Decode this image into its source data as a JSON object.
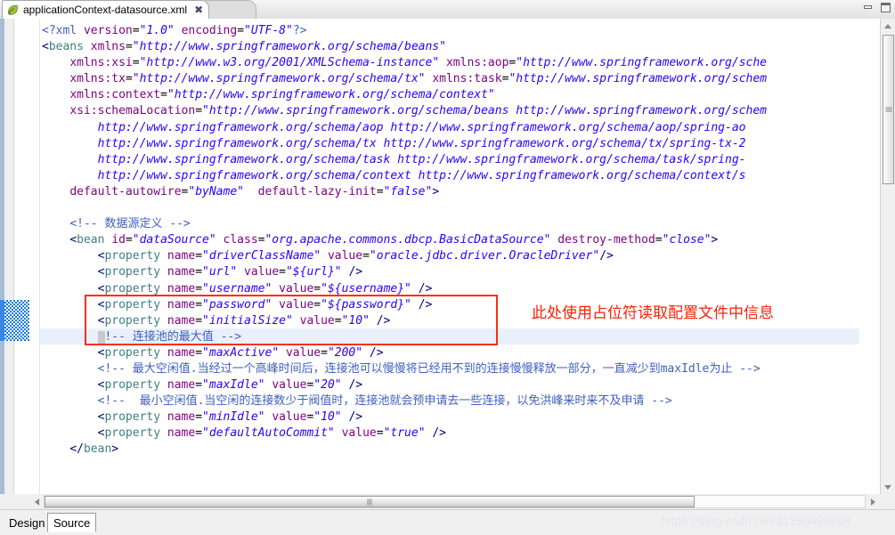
{
  "window": {
    "minimize_label": "Minimize",
    "maximize_label": "Maximize"
  },
  "tab": {
    "title": "applicationContext-datasource.xml",
    "close_label": "✖",
    "icon": "leaf-icon"
  },
  "editor": {
    "current_line_text": "<property name=\"password\" value=\"${password}\" />",
    "code_lines": [
      "<?xml version=\"1.0\" encoding=\"UTF-8\"?>",
      "<beans xmlns=\"http://www.springframework.org/schema/beans\"",
      "    xmlns:xsi=\"http://www.w3.org/2001/XMLSchema-instance\" xmlns:aop=\"http://www.springframework.org/sche",
      "    xmlns:tx=\"http://www.springframework.org/schema/tx\" xmlns:task=\"http://www.springframework.org/schem",
      "    xmlns:context=\"http://www.springframework.org/schema/context\"",
      "    xsi:schemaLocation=\"http://www.springframework.org/schema/beans http://www.springframework.org/schem",
      "        http://www.springframework.org/schema/aop http://www.springframework.org/schema/aop/spring-ao",
      "        http://www.springframework.org/schema/tx http://www.springframework.org/schema/tx/spring-tx-2",
      "        http://www.springframework.org/schema/task http://www.springframework.org/schema/task/spring-",
      "        http://www.springframework.org/schema/context http://www.springframework.org/schema/context/s",
      "    default-autowire=\"byName\"  default-lazy-init=\"false\">",
      "",
      "    <!-- 数据源定义 -->",
      "    <bean id=\"dataSource\" class=\"org.apache.commons.dbcp.BasicDataSource\" destroy-method=\"close\">",
      "        <property name=\"driverClassName\" value=\"oracle.jdbc.driver.OracleDriver\"/>",
      "        <property name=\"url\" value=\"${url}\" />",
      "        <property name=\"username\" value=\"${username}\" />",
      "        <property name=\"password\" value=\"${password}\" />",
      "        <property name=\"initialSize\" value=\"10\" />",
      "        <!-- 连接池的最大值 -->",
      "        <property name=\"maxActive\" value=\"200\" />",
      "        <!-- 最大空闲值.当经过一个高峰时间后，连接池可以慢慢将已经用不到的连接慢慢释放一部分，一直减少到maxIdle为止 -->",
      "        <property name=\"maxIdle\" value=\"20\" />",
      "        <!--  最小空闲值.当空闲的连接数少于阀值时，连接池就会预申请去一些连接，以免洪峰来时来不及申请 -->",
      "        <property name=\"minIdle\" value=\"10\" />",
      "        <property name=\"defaultAutoCommit\" value=\"true\" />",
      "    </bean>"
    ],
    "annotation_cn": "此处使用占位符读取配置文件中信息",
    "annotation_color": "#ff1f06",
    "highlight_box_color": "#ff2d0e"
  },
  "bottom_tabs": {
    "design_label": "Design",
    "source_label": "Source",
    "active": "Source"
  },
  "watermark": {
    "text": "https://blog.csdn.net/a1150499208"
  }
}
